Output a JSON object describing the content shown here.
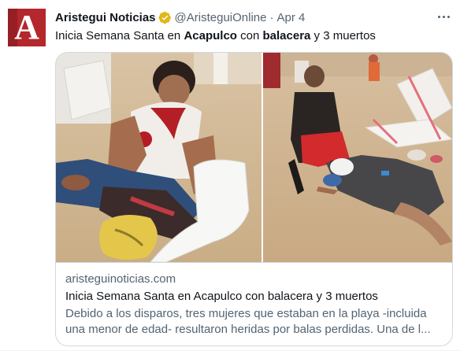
{
  "author": {
    "avatar_logo_text": "A",
    "display_name": "Aristegui Noticias",
    "handle": "@AristeguiOnline",
    "separator": "·",
    "timestamp": "Apr 4",
    "badge_icon": "verified-gold-badge-icon",
    "avatar_color": "#b3272d"
  },
  "tweet": {
    "text_parts": [
      "Inicia Semana Santa en ",
      "Acapulco",
      " con ",
      "balacera",
      " y 3 muertos"
    ]
  },
  "card": {
    "domain": "aristeguinoticias.com",
    "title": "Inicia Semana Santa en Acapulco con balacera y 3 muertos",
    "description_lines": [
      "Debido a los disparos, tres mujeres que estaban en la playa -incluida",
      "una menor de edad- resultaron heridas por balas perdidas. Una de l..."
    ]
  },
  "colors": {
    "text_primary": "#0f1419",
    "text_secondary": "#536471",
    "border": "#cfd9de",
    "verified_gold": "#e2b719"
  }
}
